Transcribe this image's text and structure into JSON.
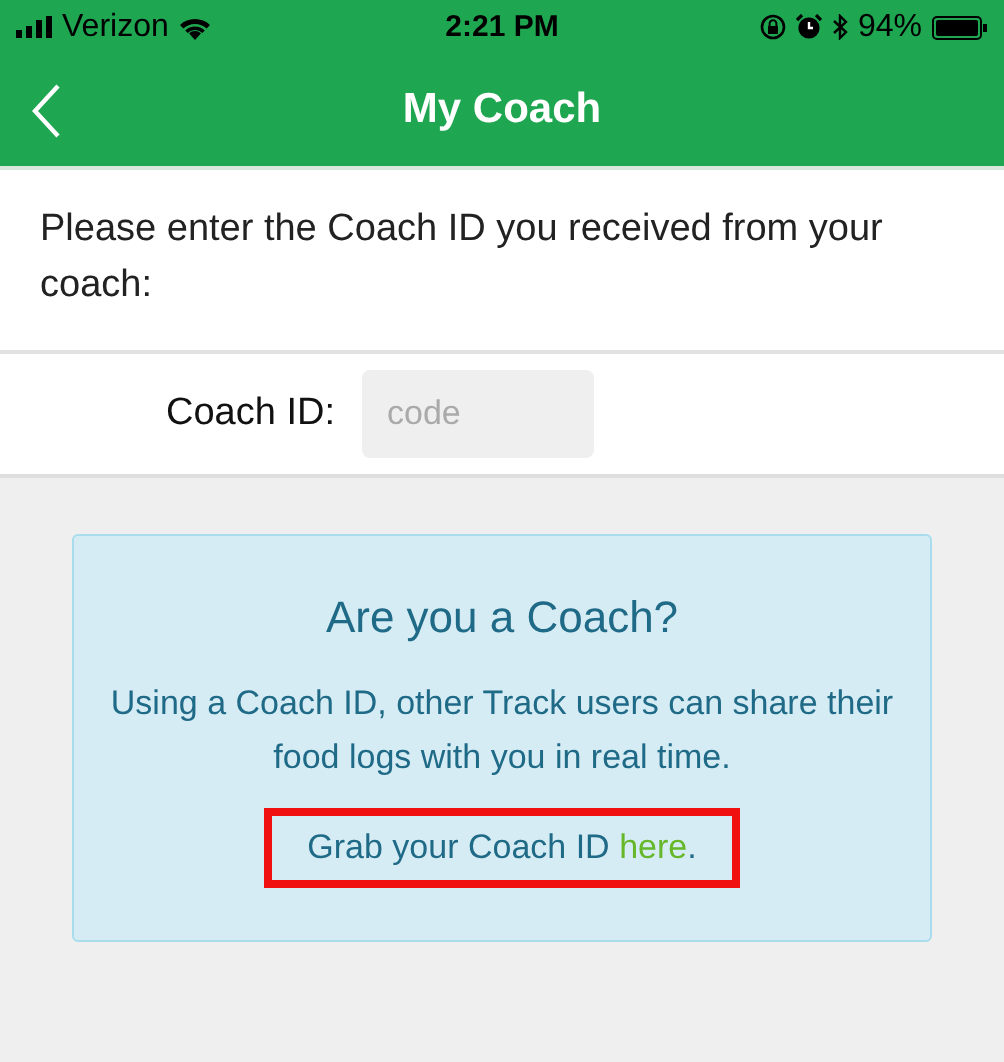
{
  "status_bar": {
    "carrier": "Verizon",
    "time": "2:21 PM",
    "battery": "94%"
  },
  "nav_bar": {
    "title": "My Coach"
  },
  "instructions": "Please enter the Coach ID you received from your coach:",
  "coach_id_field": {
    "label": "Coach ID:",
    "placeholder": "code"
  },
  "coach_card": {
    "title": "Are you a Coach?",
    "body": "Using a Coach ID, other Track users can share their food logs with you in real time.",
    "link_sentence": {
      "before": "Grab your Coach ID ",
      "link": "here",
      "after": "."
    },
    "highlighted": true
  }
}
